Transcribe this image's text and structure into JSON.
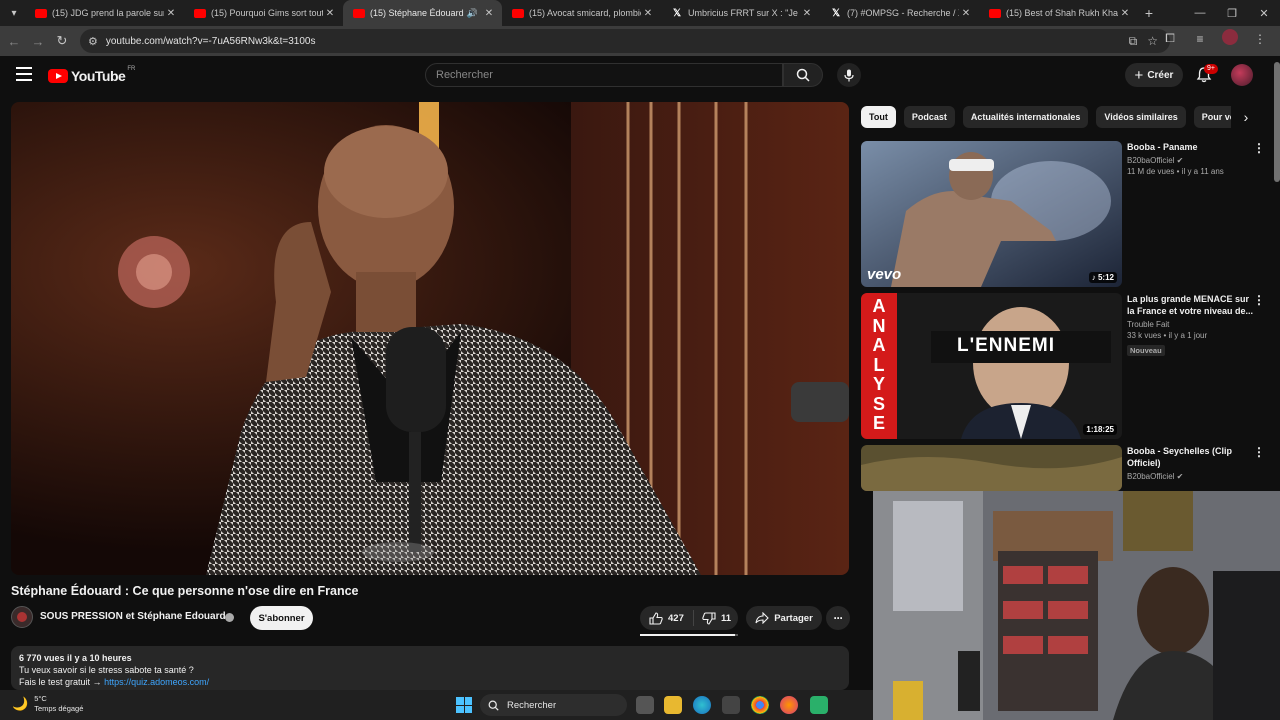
{
  "browser": {
    "tabs": [
      {
        "title": "(15) JDG prend la parole sur la",
        "favicon": "youtube-icon",
        "active": false
      },
      {
        "title": "(15) Pourquoi Gims sort tout le",
        "favicon": "youtube-icon",
        "active": false
      },
      {
        "title": "(15) Stéphane Édouard : Ce",
        "favicon": "youtube-icon",
        "active": true,
        "audio": true
      },
      {
        "title": "(15) Avocat smicard, plombier à",
        "favicon": "youtube-icon",
        "active": false
      },
      {
        "title": "Umbricius FRRT sur X : \"Je su",
        "favicon": "x-icon",
        "active": false
      },
      {
        "title": "(7) #OMPSG - Recherche / X",
        "favicon": "x-icon",
        "active": false
      },
      {
        "title": "(15) Best of Shah Rukh Khan Re",
        "favicon": "youtube-icon",
        "active": false
      }
    ],
    "url": "youtube.com/watch?v=-7uA56RNw3k&t=3100s"
  },
  "youtube": {
    "logo_text": "YouTube",
    "logo_country": "FR",
    "search_placeholder": "Rechercher",
    "create_label": "Créer",
    "notif_count": "9+"
  },
  "video": {
    "title": "Stéphane Édouard : Ce que personne n'ose dire en France",
    "channel": "SOUS PRESSION et Stéphane Edouard",
    "subscribe_label": "S'abonner",
    "likes": "427",
    "dislikes": "11",
    "like_ratio": 0.97,
    "share_label": "Partager",
    "description": {
      "meta": "6 770 vues  il y a 10 heures",
      "line1": "Tu veux savoir si le stress sabote ta santé ?",
      "line2_text": "Fais le test gratuit",
      "line2_link": "https://quiz.adomeos.com/"
    }
  },
  "chips": [
    "Tout",
    "Podcast",
    "Actualités internationales",
    "Vidéos similaires",
    "Pour vous"
  ],
  "recommendations": [
    {
      "title": "Booba - Paname",
      "channel": "B20baOfficiel",
      "verified": true,
      "stats": "11 M de vues • il y a 11 ans",
      "duration": "5:12",
      "thumb_text": "vevo"
    },
    {
      "title": "La plus grande MENACE sur la France et votre niveau de...",
      "channel": "Trouble Fait",
      "verified": false,
      "stats": "33 k vues • il y a 1 jour",
      "badge": "Nouveau",
      "duration": "1:18:25",
      "thumb_text": "L'ENNEMI",
      "thumb_side_text": "ANALYSE"
    },
    {
      "title": "Booba - Seychelles (Clip Officiel)",
      "channel": "B20baOfficiel",
      "verified": true,
      "stats": "",
      "duration": "",
      "thumb_text": ""
    }
  ],
  "taskbar": {
    "weather_temp": "5°C",
    "weather_desc": "Temps dégagé",
    "search_label": "Rechercher"
  },
  "colors": {
    "background": "#0f0f0f",
    "brand_red": "#ff0000",
    "link": "#3ea6ff",
    "chip_active": "#f1f1f1"
  }
}
